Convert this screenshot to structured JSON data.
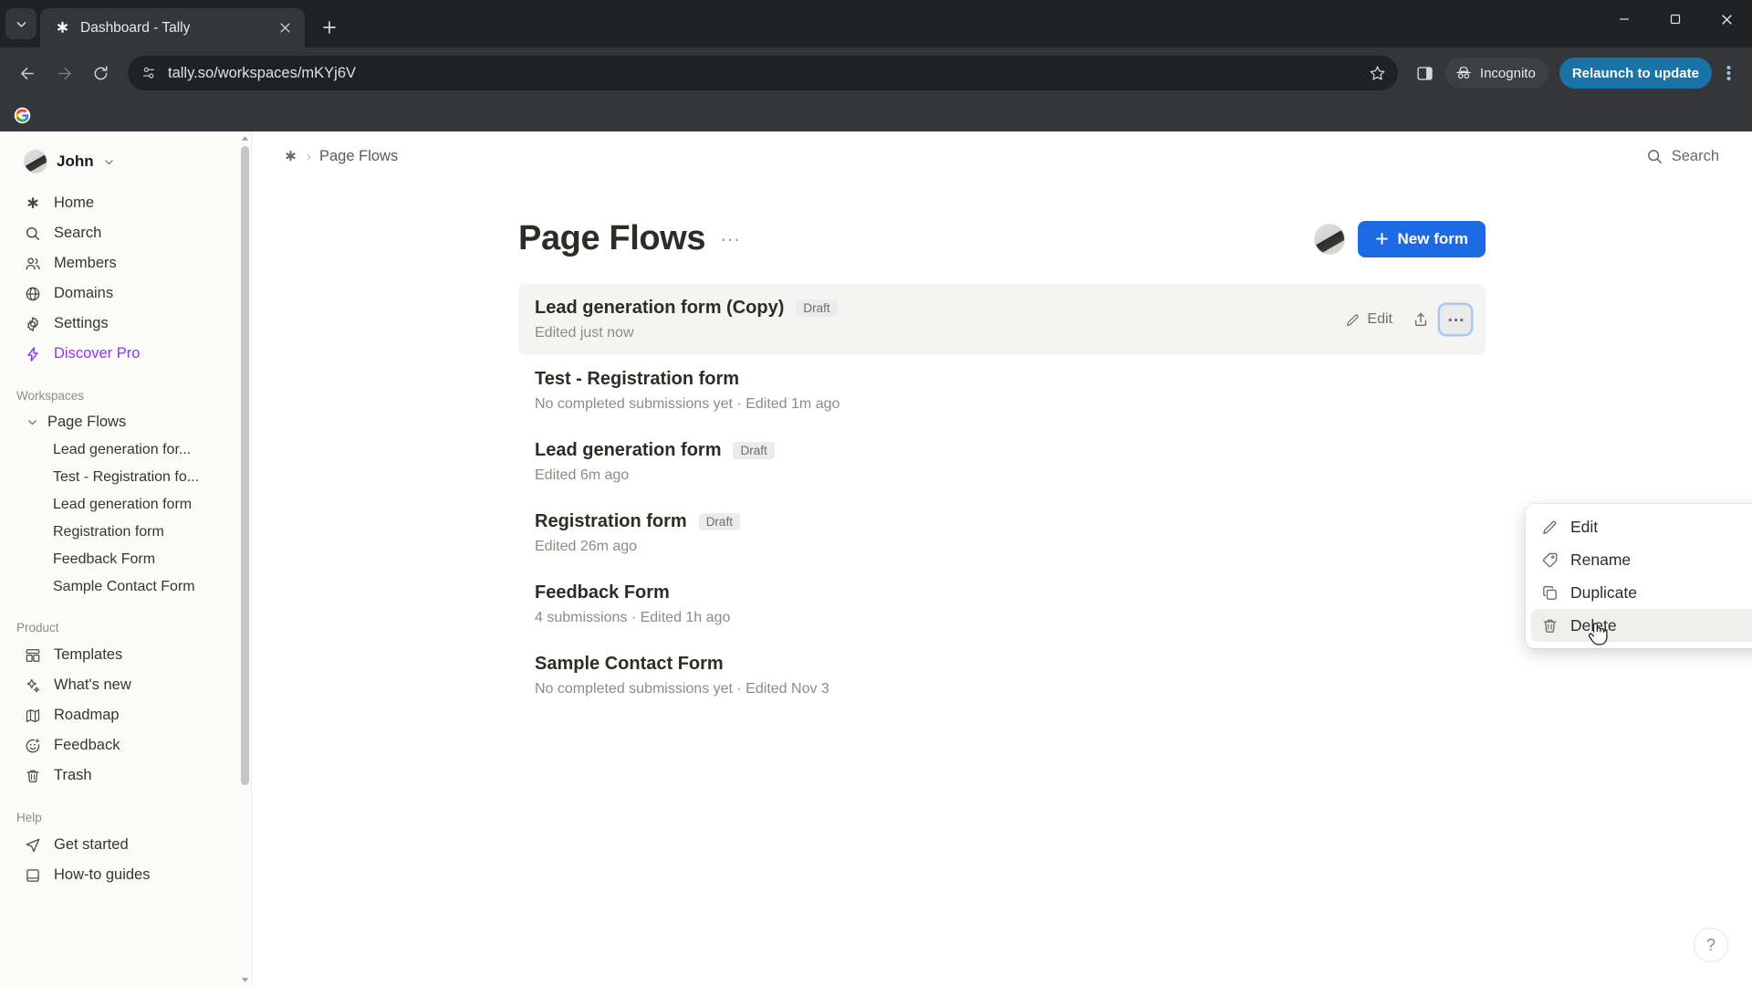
{
  "browser": {
    "tab": {
      "title": "Dashboard - Tally",
      "favicon": "asterisk-icon"
    },
    "tab_list_icon": "chevron-down-icon",
    "new_tab_icon": "plus-icon",
    "close_icon": "close-icon",
    "nav": {
      "back": "back-arrow-icon",
      "forward": "forward-arrow-icon",
      "reload": "reload-icon"
    },
    "omnibox": {
      "url": "tally.so/workspaces/mKYj6V",
      "site_icon": "site-settings-icon",
      "star_icon": "bookmark-star-icon"
    },
    "side_panel_icon": "side-panel-icon",
    "incognito": {
      "label": "Incognito",
      "icon": "incognito-icon"
    },
    "relaunch": {
      "label": "Relaunch to update"
    },
    "menu_icon": "three-dots-vertical-icon",
    "window": {
      "minimize": "minimize-icon",
      "maximize": "maximize-icon",
      "close": "window-close-icon"
    },
    "bookmarks": [
      {
        "name": "google-bookmark",
        "icon": "google-icon"
      }
    ]
  },
  "sidebar": {
    "user": {
      "name": "John",
      "chevron": "chevron-down-icon"
    },
    "nav": [
      {
        "label": "Home",
        "icon": "asterisk-icon"
      },
      {
        "label": "Search",
        "icon": "search-icon"
      },
      {
        "label": "Members",
        "icon": "members-icon"
      },
      {
        "label": "Domains",
        "icon": "globe-icon"
      },
      {
        "label": "Settings",
        "icon": "gear-icon"
      },
      {
        "label": "Discover Pro",
        "icon": "lightning-icon",
        "accent": "#9333ea"
      }
    ],
    "workspaces_label": "Workspaces",
    "workspace": {
      "label": "Page Flows",
      "chevron": "chevron-down-icon"
    },
    "workspace_children": [
      "Lead generation for...",
      "Test - Registration fo...",
      "Lead generation form",
      "Registration form",
      "Feedback Form",
      "Sample Contact Form"
    ],
    "product_label": "Product",
    "product": [
      {
        "label": "Templates",
        "icon": "templates-icon"
      },
      {
        "label": "What's new",
        "icon": "sparkles-icon"
      },
      {
        "label": "Roadmap",
        "icon": "map-icon"
      },
      {
        "label": "Feedback",
        "icon": "smiley-plus-icon"
      },
      {
        "label": "Trash",
        "icon": "trash-icon"
      }
    ],
    "help_label": "Help",
    "help": [
      {
        "label": "Get started",
        "icon": "paper-plane-icon"
      },
      {
        "label": "How-to guides",
        "icon": "book-icon"
      }
    ]
  },
  "topbar": {
    "breadcrumb_home_icon": "asterisk-icon",
    "breadcrumb_sep": "›",
    "breadcrumb": "Page Flows",
    "search": {
      "label": "Search",
      "icon": "search-icon"
    }
  },
  "page": {
    "title": "Page Flows",
    "title_menu_icon": "three-dots-icon",
    "new_form": {
      "label": "New form",
      "icon": "plus-icon",
      "color": "#1d6ae5"
    },
    "avatar": "workspace-avatar"
  },
  "forms": [
    {
      "title": "Lead generation form (Copy)",
      "badge": "Draft",
      "meta": "Edited just now",
      "active": true,
      "actions": {
        "edit_label": "Edit",
        "edit_icon": "pencil-icon",
        "share_icon": "share-icon",
        "more_icon": "three-dots-icon"
      }
    },
    {
      "title": "Test - Registration form",
      "badge": "",
      "meta": "No completed submissions yet · Edited 1m ago",
      "active": false
    },
    {
      "title": "Lead generation form",
      "badge": "Draft",
      "meta": "Edited 6m ago",
      "active": false
    },
    {
      "title": "Registration form",
      "badge": "Draft",
      "meta": "Edited 26m ago",
      "active": false
    },
    {
      "title": "Feedback Form",
      "badge": "",
      "meta": "4 submissions · Edited 1h ago",
      "active": false
    },
    {
      "title": "Sample Contact Form",
      "badge": "",
      "meta": "No completed submissions yet · Edited Nov 3",
      "active": false
    }
  ],
  "context_menu": {
    "items": [
      {
        "label": "Edit",
        "icon": "pencil-icon",
        "highlighted": false
      },
      {
        "label": "Rename",
        "icon": "tag-icon",
        "highlighted": false
      },
      {
        "label": "Duplicate",
        "icon": "copy-icon",
        "highlighted": false
      },
      {
        "label": "Delete",
        "icon": "trash-icon",
        "highlighted": true
      }
    ]
  },
  "help_button": {
    "label": "?"
  }
}
